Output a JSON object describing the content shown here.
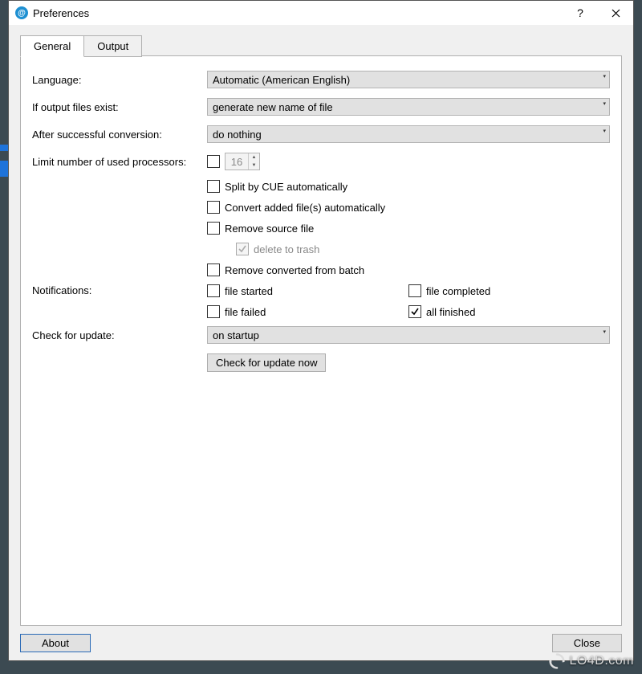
{
  "window": {
    "title": "Preferences"
  },
  "tabs": {
    "general": "General",
    "output": "Output"
  },
  "labels": {
    "language": "Language:",
    "if_output": "If output files exist:",
    "after_conv": "After successful conversion:",
    "limit_procs": "Limit number of used processors:",
    "notifications": "Notifications:",
    "check_update": "Check for update:"
  },
  "values": {
    "language": "Automatic (American English)",
    "if_output": "generate new name of file",
    "after_conv": "do nothing",
    "procs": "16",
    "check_update": "on startup"
  },
  "checks": {
    "split_cue": "Split by CUE automatically",
    "convert_auto": "Convert added file(s) automatically",
    "remove_source": "Remove source file",
    "delete_trash": "delete to trash",
    "remove_converted": "Remove converted from batch",
    "file_started": "file started",
    "file_completed": "file completed",
    "file_failed": "file failed",
    "all_finished": "all finished"
  },
  "buttons": {
    "check_now": "Check for update now",
    "about": "About",
    "close": "Close"
  },
  "watermark": "LO4D.com"
}
